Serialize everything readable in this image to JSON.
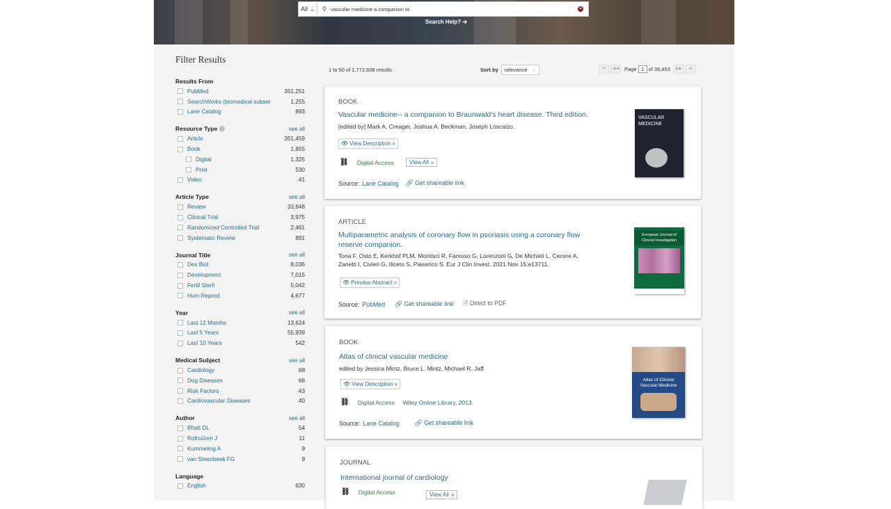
{
  "search": {
    "scope": "All",
    "query": "vascular medicine a companion to",
    "help_label": "Search Help? ➔"
  },
  "sidebar": {
    "title": "Filter Results",
    "see_all": "see all",
    "facets": [
      {
        "name": "Results From",
        "items": [
          {
            "label": "PubMed",
            "count": "351,251"
          },
          {
            "label": "SearchWorks (biomedical subset)",
            "count": "1,255"
          },
          {
            "label": "Lane Catalog",
            "count": "893"
          }
        ]
      },
      {
        "name": "Resource Type",
        "items": [
          {
            "label": "Article",
            "count": "351,459"
          },
          {
            "label": "Book",
            "count": "1,855"
          },
          {
            "label": "Digital",
            "count": "1,325"
          },
          {
            "label": "Print",
            "count": "530"
          },
          {
            "label": "Video",
            "count": "41"
          }
        ]
      },
      {
        "name": "Article Type",
        "items": [
          {
            "label": "Review",
            "count": "33,648"
          },
          {
            "label": "Clinical Trial",
            "count": "3,975"
          },
          {
            "label": "Randomized Controlled Trial",
            "count": "2,461"
          },
          {
            "label": "Systematic Review",
            "count": "891"
          }
        ]
      },
      {
        "name": "Journal Title",
        "items": [
          {
            "label": "Dev Biol",
            "count": "8,036"
          },
          {
            "label": "Development",
            "count": "7,015"
          },
          {
            "label": "Fertil Steril",
            "count": "5,042"
          },
          {
            "label": "Hum Reprod",
            "count": "4,677"
          }
        ]
      },
      {
        "name": "Year",
        "items": [
          {
            "label": "Last 12 Months",
            "count": "13,624"
          },
          {
            "label": "Last 5 Years",
            "count": "55,939"
          },
          {
            "label": "Last 10 Years",
            "count": "542"
          }
        ]
      },
      {
        "name": "Medical Subject",
        "items": [
          {
            "label": "Cardiology",
            "count": "68"
          },
          {
            "label": "Dog Diseases",
            "count": "68"
          },
          {
            "label": "Risk Factors",
            "count": "43"
          },
          {
            "label": "Cardiovascular Diseases",
            "count": "40"
          }
        ]
      },
      {
        "name": "Author",
        "items": [
          {
            "label": "Bhatt DL",
            "count": "54"
          },
          {
            "label": "Rothuizen J",
            "count": "11"
          },
          {
            "label": "Kummeling A",
            "count": "9"
          },
          {
            "label": "van Steenbeek FG",
            "count": "9"
          }
        ]
      },
      {
        "name": "Language",
        "items": [
          {
            "label": "English",
            "count": "630"
          }
        ]
      }
    ]
  },
  "results_bar": {
    "count_text": "1 to 50 of 1,772,608 results",
    "sort_label": "Sort by",
    "sort_value": "relevance",
    "page_label": "Page",
    "page_value": "1",
    "page_of": "of 35,453"
  },
  "results": [
    {
      "type": "BOOK",
      "title": "Vascular medicine-- a companion to Braunwald's heart disease. Third edition.",
      "authors": "[edited by] Mark A. Creager, Joshua A. Beckman, Joseph Loscalzo.",
      "desc_button": "View Description",
      "access": "Digital Access",
      "view_all": "View All",
      "source_label": "Source:",
      "source": "Lane Catalog",
      "share": "Get shareable link"
    },
    {
      "type": "ARTICLE",
      "title": "Multiparametric analysis of coronary flow in psoriasis using a coronary flow reserve companion.",
      "authors": "Tona F, Osto E, Kerkhof PLM, Montisci R, Famoso G, Lorenzoni G, De Michieli L, Cecere A, Zanetti I, Civieri G, Iliceto S, Piaserico S. Eur J Clin Invest. 2021 Nov 15:e13711.",
      "desc_button": "Preview Abstract",
      "source_label": "Source:",
      "source": "PubMed",
      "share": "Get shareable link",
      "pdf": "Direct to PDF"
    },
    {
      "type": "BOOK",
      "title": "Atlas of clinical vascular medicine",
      "authors": "edited by Jessica Mintz, Bruce L. Mintz, Michael R. Jaff.",
      "desc_button": "View Description",
      "access": "Digital Access",
      "publisher": "Wiley Online Library, 2013.",
      "source_label": "Source:",
      "source": "Lane Catalog",
      "share": "Get shareable link"
    },
    {
      "type": "JOURNAL",
      "title": "International journal of cardiology",
      "access": "Digital Access",
      "view_all": "View All"
    }
  ],
  "covers": {
    "cover1": {
      "line1": "VASCULAR",
      "line2": "MEDICINE"
    },
    "cover2": {
      "line1": "European Journal of",
      "line2": "Clinical Investigation"
    },
    "cover3": {
      "line1": "Atlas of Clinical",
      "line2": "Vascular Medicine"
    }
  }
}
